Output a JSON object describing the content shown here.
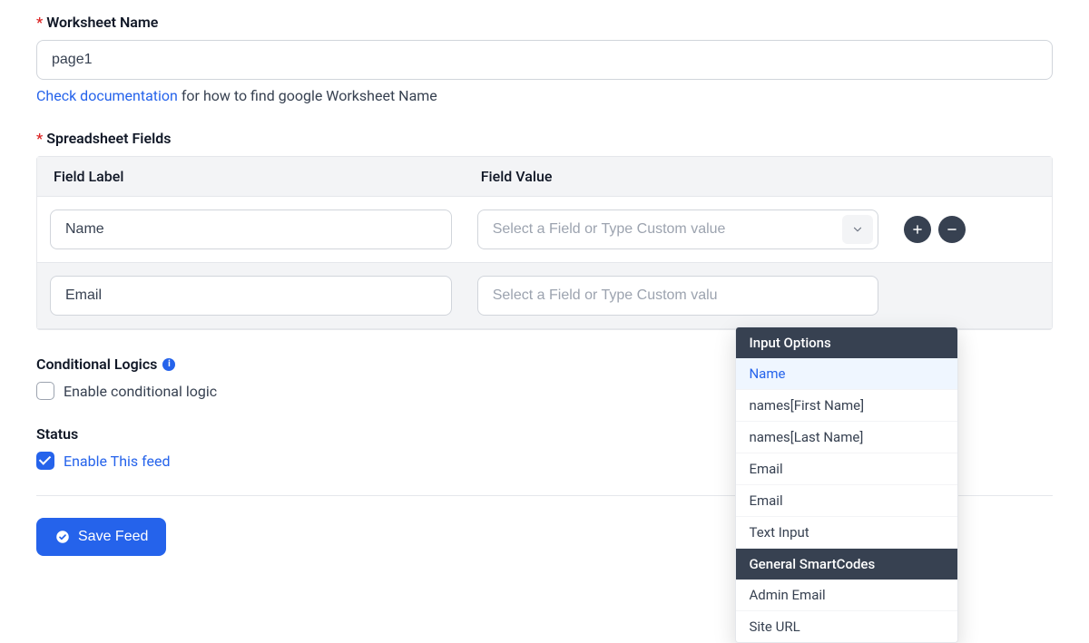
{
  "worksheet": {
    "label": "Worksheet Name",
    "value": "page1",
    "help_link_text": "Check documentation",
    "help_rest": " for how to find google Worksheet Name"
  },
  "fields_section": {
    "label": "Spreadsheet Fields",
    "columns": {
      "label": "Field Label",
      "value": "Field Value"
    },
    "rows": [
      {
        "label": "Name",
        "value_placeholder": "Select a Field or Type Custom value"
      },
      {
        "label": "Email",
        "value_placeholder": "Select a Field or Type Custom valu"
      }
    ]
  },
  "dropdown": {
    "group1_header": "Input Options",
    "group1_options": [
      "Name",
      "names[First Name]",
      "names[Last Name]",
      "Email",
      "Email",
      "Text Input"
    ],
    "group2_header": "General SmartCodes",
    "group2_options": [
      "Admin Email",
      "Site URL"
    ]
  },
  "conditional": {
    "title": "Conditional Logics",
    "checkbox_label": "Enable conditional logic",
    "checked": false
  },
  "status": {
    "title": "Status",
    "checkbox_label": "Enable This feed",
    "checked": true
  },
  "save_btn": "Save Feed",
  "icons": {
    "plus": "plus-icon",
    "minus": "minus-icon",
    "chevron": "chevron-down-icon",
    "info": "info-icon"
  }
}
